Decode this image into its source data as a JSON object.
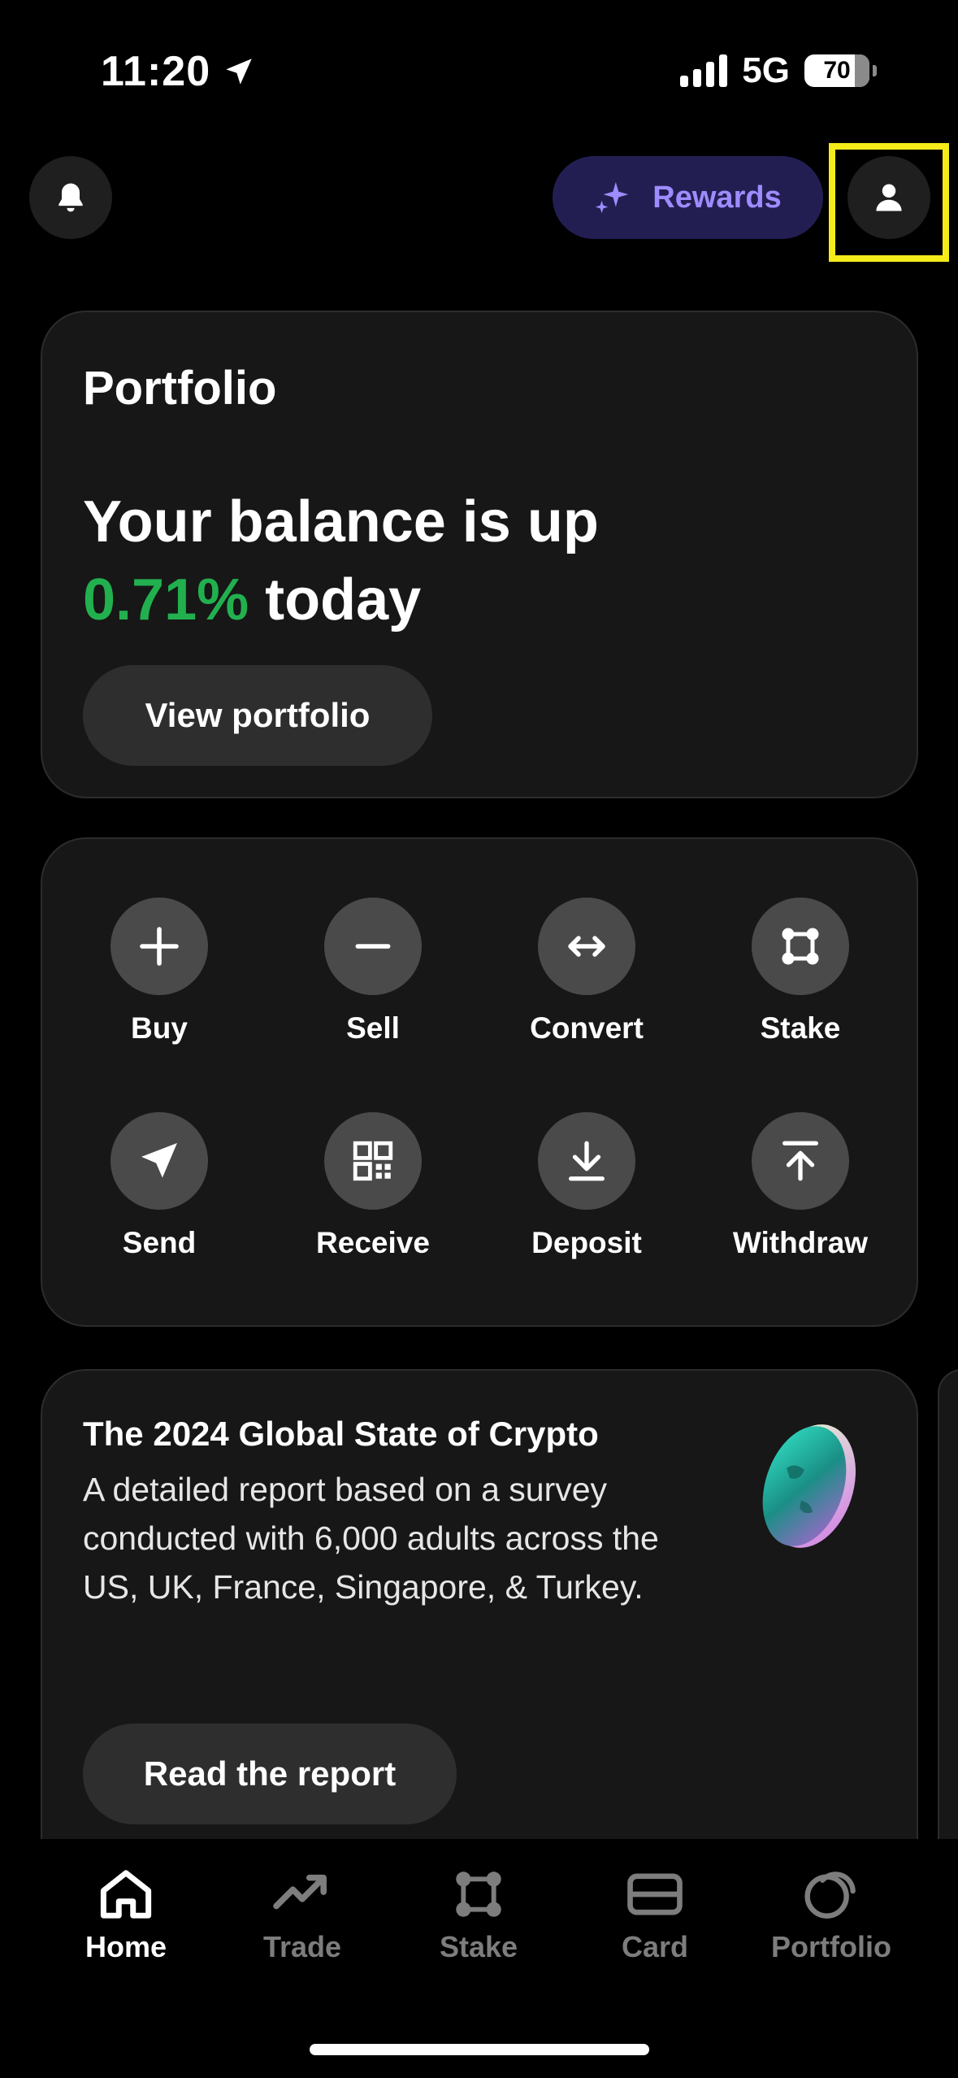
{
  "status_bar": {
    "time": "11:20",
    "network": "5G",
    "battery": "70"
  },
  "header": {
    "rewards_label": "Rewards"
  },
  "portfolio": {
    "title": "Portfolio",
    "headline_line1": "Your balance is up",
    "change_percent": "0.71%",
    "headline_suffix": " today",
    "button_label": "View portfolio"
  },
  "actions": [
    {
      "label": "Buy",
      "icon": "plus-icon"
    },
    {
      "label": "Sell",
      "icon": "minus-icon"
    },
    {
      "label": "Convert",
      "icon": "arrows-horizontal-icon"
    },
    {
      "label": "Stake",
      "icon": "stake-icon"
    },
    {
      "label": "Send",
      "icon": "send-icon"
    },
    {
      "label": "Receive",
      "icon": "qr-code-icon"
    },
    {
      "label": "Deposit",
      "icon": "deposit-icon"
    },
    {
      "label": "Withdraw",
      "icon": "withdraw-icon"
    }
  ],
  "report": {
    "title": "The 2024 Global State of Crypto",
    "body": "A detailed report based on a survey conducted with 6,000 adults across the US, UK, France, Singapore, & Turkey.",
    "button_label": "Read the report"
  },
  "bottom_nav": [
    {
      "label": "Home",
      "icon": "home-icon",
      "active": true
    },
    {
      "label": "Trade",
      "icon": "trend-up-icon",
      "active": false
    },
    {
      "label": "Stake",
      "icon": "stake-icon",
      "active": false
    },
    {
      "label": "Card",
      "icon": "card-icon",
      "active": false
    },
    {
      "label": "Portfolio",
      "icon": "portfolio-icon",
      "active": false
    }
  ],
  "colors": {
    "background": "#000000",
    "card": "#171717",
    "positive": "#22b04f",
    "rewards_bg": "#231e52",
    "rewards_text": "#9d8cff",
    "highlight": "#f5ec1a"
  }
}
